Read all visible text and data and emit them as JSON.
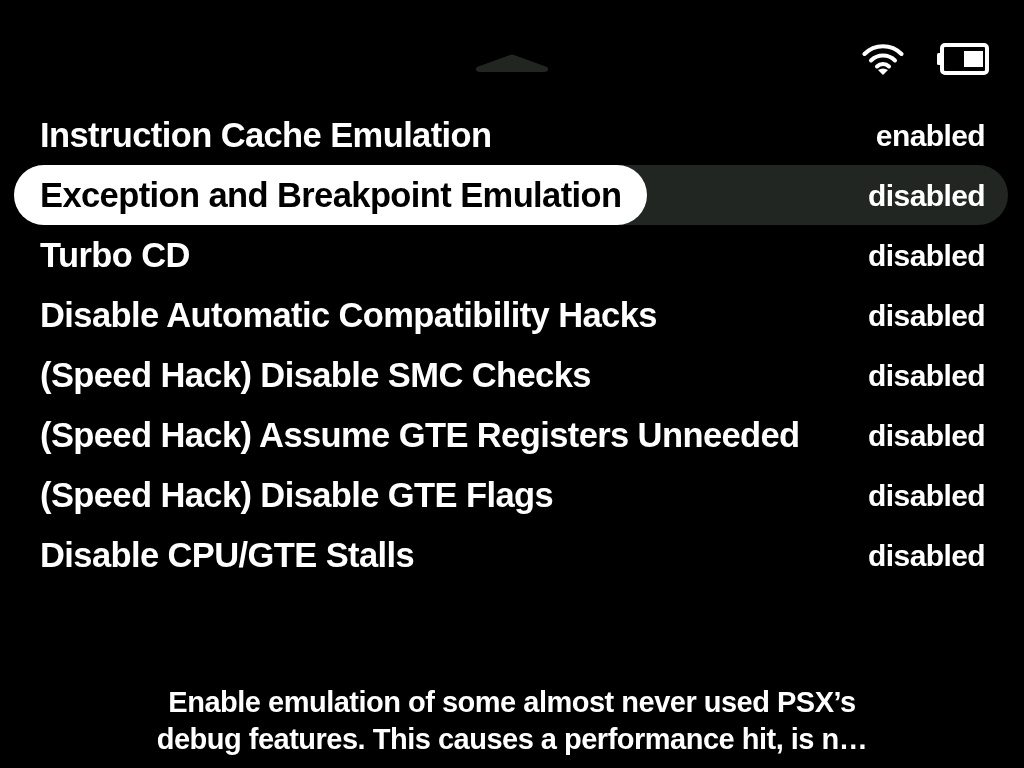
{
  "options": [
    {
      "label": "Instruction Cache Emulation",
      "value": "enabled",
      "selected": false
    },
    {
      "label": "Exception and Breakpoint Emulation",
      "value": "disabled",
      "selected": true
    },
    {
      "label": "Turbo CD",
      "value": "disabled",
      "selected": false
    },
    {
      "label": "Disable Automatic Compatibility Hacks",
      "value": "disabled",
      "selected": false
    },
    {
      "label": "(Speed Hack) Disable SMC Checks",
      "value": "disabled",
      "selected": false
    },
    {
      "label": "(Speed Hack) Assume GTE Registers Unneeded",
      "value": "disabled",
      "selected": false
    },
    {
      "label": "(Speed Hack) Disable GTE Flags",
      "value": "disabled",
      "selected": false
    },
    {
      "label": "Disable CPU/GTE Stalls",
      "value": "disabled",
      "selected": false
    }
  ],
  "description": "Enable emulation of some almost never used PSX’s debug features. This causes a performance hit, is n…"
}
